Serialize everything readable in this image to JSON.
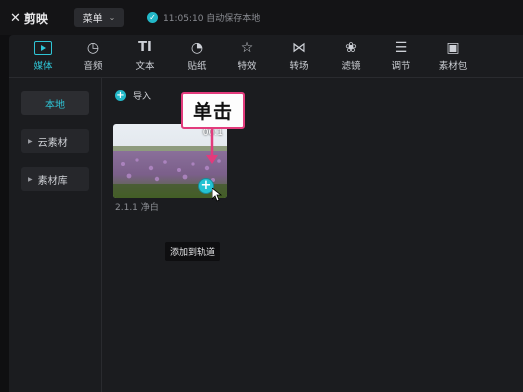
{
  "app": {
    "name": "剪映",
    "menu_label": "菜单",
    "save_status": "11:05:10 自动保存本地"
  },
  "toolbar": [
    {
      "label": "媒体",
      "icon": "media-icon"
    },
    {
      "label": "音频",
      "icon": "audio-icon"
    },
    {
      "label": "文本",
      "icon": "text-icon"
    },
    {
      "label": "贴纸",
      "icon": "sticker-icon"
    },
    {
      "label": "特效",
      "icon": "effects-icon"
    },
    {
      "label": "转场",
      "icon": "transition-icon"
    },
    {
      "label": "滤镜",
      "icon": "filter-icon"
    },
    {
      "label": "调节",
      "icon": "adjust-icon"
    },
    {
      "label": "素材包",
      "icon": "package-icon"
    }
  ],
  "sidebar": {
    "items": [
      {
        "label": "本地"
      },
      {
        "label": "云素材"
      },
      {
        "label": "素材库"
      }
    ]
  },
  "content": {
    "import_label": "导入",
    "media_item": {
      "duration": "00:1",
      "filename": "2.1.1 净白"
    },
    "tooltip": "添加到轨道"
  },
  "annotation": {
    "callout_text": "单击",
    "accent_color": "#e23b7c"
  },
  "colors": {
    "accent": "#2fc5d6",
    "background": "#1b1c1f"
  }
}
